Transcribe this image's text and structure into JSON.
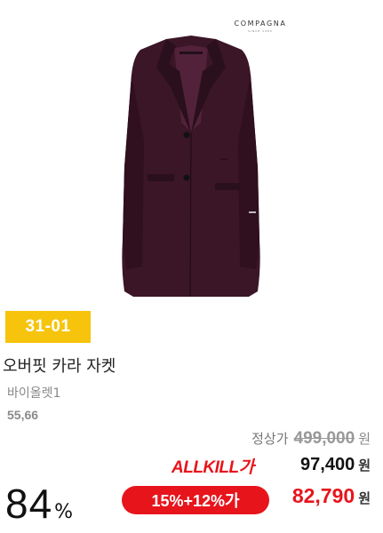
{
  "brand": {
    "name": "COMPAGNA",
    "sub": "SINCE 1985"
  },
  "badge": {
    "code": "31-01"
  },
  "product": {
    "name": "오버핏 카라 자켓",
    "color": "바이올렛1",
    "sizes": "55,66"
  },
  "pricing": {
    "regular_label": "정상가",
    "regular_price": "499,000",
    "currency": "원",
    "allkill_logo": "ALLKILL가",
    "allkill_price": "97,400",
    "discount_label": "15%+12%가",
    "final_price": "82,790",
    "rate_value": "84",
    "rate_unit": "%"
  },
  "colors": {
    "badge": "#f6c40c",
    "accent_red": "#e8141c",
    "jacket": "#3a1626"
  },
  "icons": {
    "product_image": "jacket-image"
  }
}
